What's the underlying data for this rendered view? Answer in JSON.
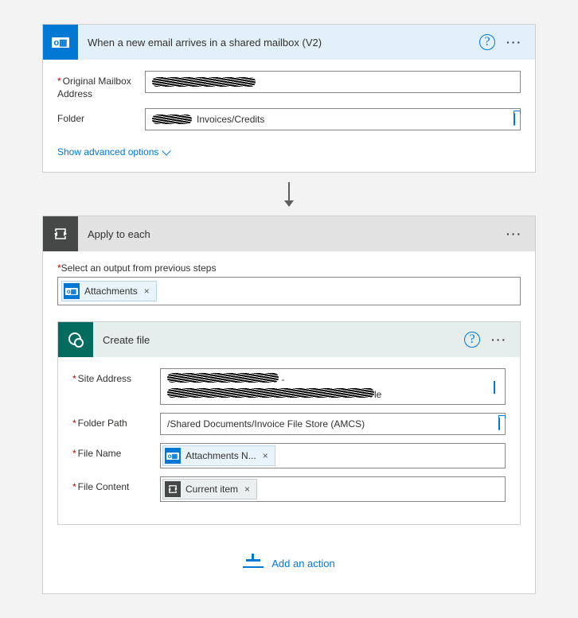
{
  "trigger": {
    "title": "When a new email arrives in a shared mailbox (V2)",
    "fields": {
      "mailbox_label": "Original Mailbox Address",
      "folder_label": "Folder",
      "folder_value": "Invoices/Credits"
    },
    "show_advanced": "Show advanced options"
  },
  "apply": {
    "title": "Apply to each",
    "select_label": "Select an output from previous steps",
    "token": "Attachments"
  },
  "create": {
    "title": "Create file",
    "site_label": "Site Address",
    "folder_label": "Folder Path",
    "folder_value": "/Shared Documents/Invoice File Store (AMCS)",
    "filename_label": "File Name",
    "filename_token": "Attachments N...",
    "content_label": "File Content",
    "content_token": "Current item"
  },
  "add_action": "Add an action"
}
